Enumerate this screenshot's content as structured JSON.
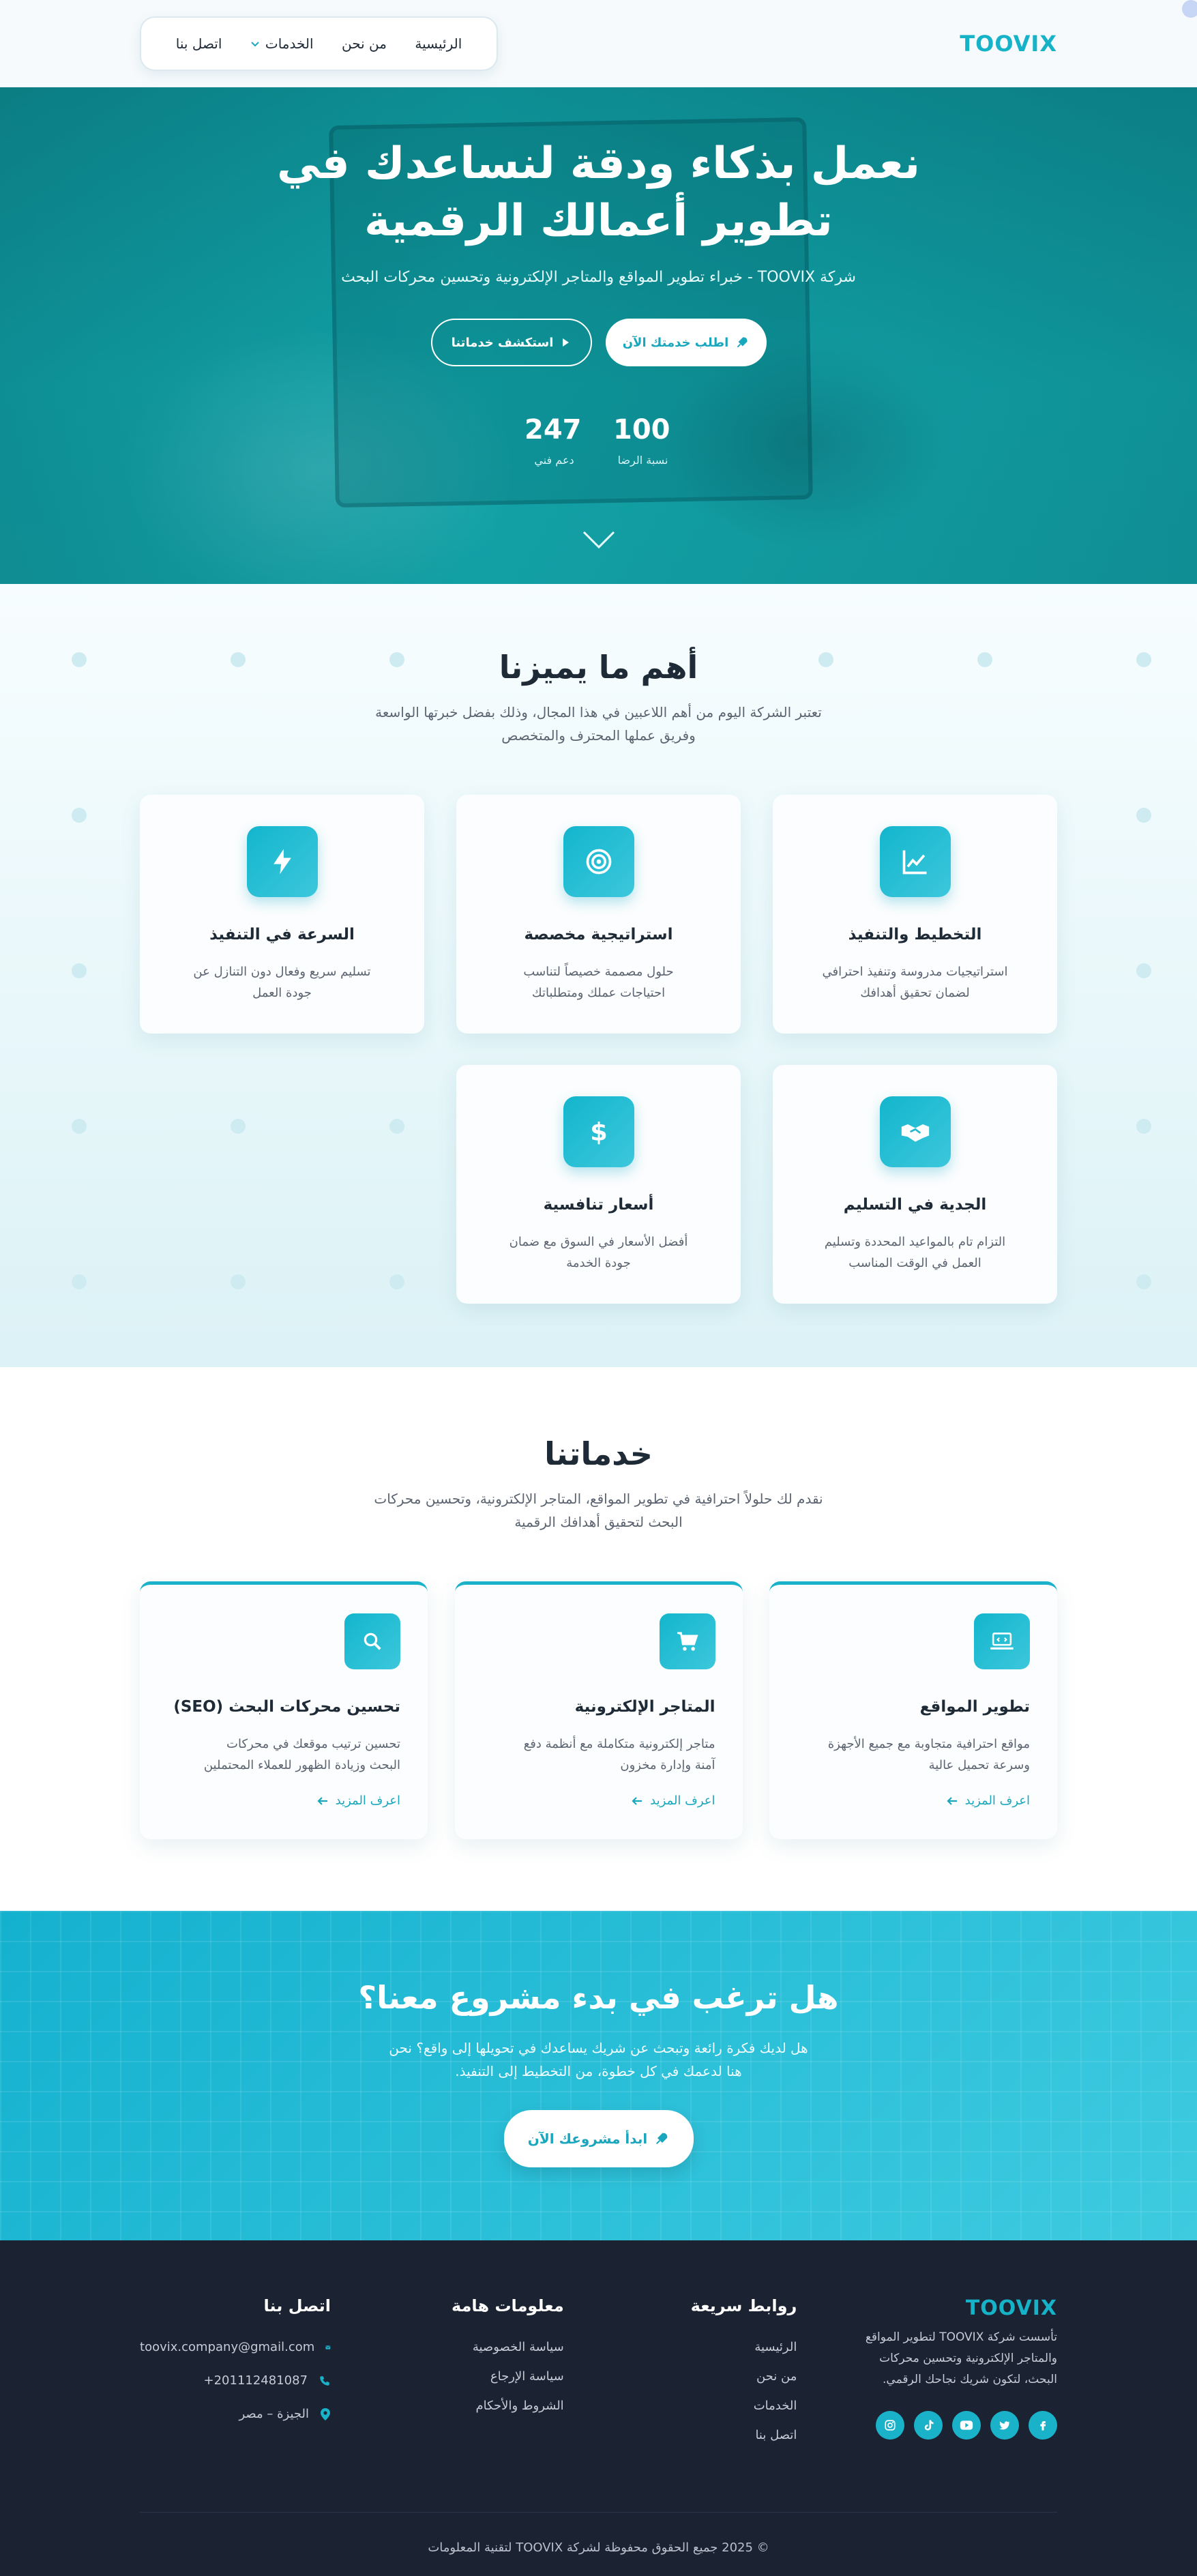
{
  "brand": {
    "logo": "TOOVIX",
    "accent": "#1ab2c9",
    "dark": "#1b2232"
  },
  "nav": {
    "items": [
      {
        "label": "الرئيسية"
      },
      {
        "label": "من نحن"
      },
      {
        "label": "الخدمات",
        "icon": "chevron-down-icon"
      },
      {
        "label": "اتصل بنا"
      }
    ]
  },
  "hero": {
    "title_line1": "نعمل بذكاء ودقة لنساعدك في",
    "title_line2": "تطوير أعمالك الرقمية",
    "subtitle": "شركة TOOVIX - خبراء تطوير المواقع والمتاجر الإلكترونية وتحسين محركات البحث",
    "primary_btn": "اطلب خدمتك الآن",
    "secondary_btn": "استكشف خدماتنا",
    "stats": [
      {
        "value": "100",
        "label": "نسبة الرضا"
      },
      {
        "value": "247",
        "label": "دعم فني"
      }
    ]
  },
  "features": {
    "title": "أهم ما يميزنا",
    "subtitle": "تعتبر الشركة اليوم من أهم اللاعبين في هذا المجال، وذلك بفضل خبرتها الواسعة وفريق عملها المحترف والمتخصص",
    "cards": [
      {
        "icon": "chart-line-icon",
        "title": "التخطيط والتنفيذ",
        "desc": "استراتيجيات مدروسة وتنفيذ احترافي لضمان تحقيق أهدافك"
      },
      {
        "icon": "target-icon",
        "title": "استراتيجية مخصصة",
        "desc": "حلول مصممة خصيصاً لتناسب احتياجات عملك ومتطلباتك"
      },
      {
        "icon": "bolt-icon",
        "title": "السرعة في التنفيذ",
        "desc": "تسليم سريع وفعال دون التنازل عن جودة العمل"
      },
      {
        "icon": "handshake-icon",
        "title": "الجدية في التسليم",
        "desc": "التزام تام بالمواعيد المحددة وتسليم العمل في الوقت المناسب"
      },
      {
        "icon": "dollar-icon",
        "title": "أسعار تنافسية",
        "desc": "أفضل الأسعار في السوق مع ضمان جودة الخدمة"
      }
    ]
  },
  "services": {
    "title": "خدماتنا",
    "subtitle": "نقدم لك حلولاً احترافية في تطوير المواقع، المتاجر الإلكترونية، وتحسين محركات البحث لتحقيق أهدافك الرقمية",
    "more_label": "اعرف المزيد",
    "cards": [
      {
        "icon": "laptop-code-icon",
        "title": "تطوير المواقع",
        "desc": "مواقع احترافية متجاوبة مع جميع الأجهزة وسرعة تحميل عالية"
      },
      {
        "icon": "cart-icon",
        "title": "المتاجر الإلكترونية",
        "desc": "متاجر إلكترونية متكاملة مع أنظمة دفع آمنة وإدارة مخزون"
      },
      {
        "icon": "search-icon",
        "title": "تحسين محركات البحث (SEO)",
        "desc": "تحسين ترتيب موقعك في محركات البحث وزيادة الظهور للعملاء المحتملين"
      }
    ]
  },
  "cta": {
    "title": "هل ترغب في بدء مشروع معنا؟",
    "subtitle": "هل لديك فكرة رائعة وتبحث عن شريك يساعدك في تحويلها إلى واقع؟ نحن هنا لدعمك في كل خطوة، من التخطيط إلى التنفيذ.",
    "button": "ابدأ مشروعك الآن"
  },
  "footer": {
    "logo": "TOOVIX",
    "about": "تأسست شركة TOOVIX لتطوير المواقع والمتاجر الإلكترونية وتحسين محركات البحث، لتكون شريك نجاحك الرقمي.",
    "socials": [
      "facebook-icon",
      "twitter-icon",
      "youtube-icon",
      "tiktok-icon",
      "instagram-icon"
    ],
    "quick_links": {
      "title": "روابط سريعة",
      "items": [
        "الرئيسية",
        "من نحن",
        "الخدمات",
        "اتصل بنا"
      ]
    },
    "info": {
      "title": "معلومات هامة",
      "items": [
        "سياسة الخصوصية",
        "سياسة الإرجاع",
        "الشروط والأحكام"
      ]
    },
    "contact": {
      "title": "اتصل بنا",
      "email": "toovix.company@gmail.com",
      "phone": "+201112481087",
      "location": "الجيزة – مصر"
    },
    "copyright": "© 2025 جميع الحقوق محفوظة لشركة TOOVIX لتقنية المعلومات"
  }
}
